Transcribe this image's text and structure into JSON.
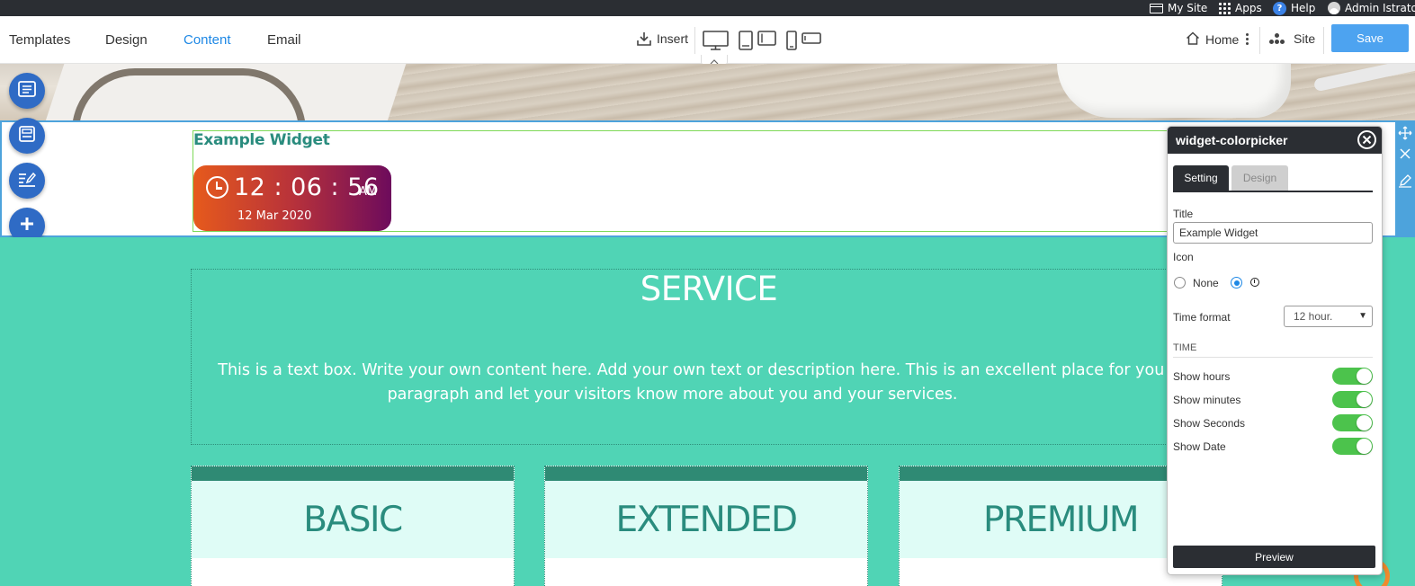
{
  "adminbar": {
    "my_site": "My Site",
    "apps": "Apps",
    "help": "Help",
    "user": "Admin Istrator",
    "help_glyph": "?"
  },
  "toolbar": {
    "menu": [
      "Templates",
      "Design",
      "Content",
      "Email"
    ],
    "active_menu": "Content",
    "insert_label": "Insert",
    "home_label": "Home",
    "site_label": "Site",
    "save_label": "Save"
  },
  "widget": {
    "title": "Example Widget",
    "time": "12 : 06 : 56",
    "ampm": "AM",
    "date": "12 Mar 2020"
  },
  "services": {
    "title": "SERVICE",
    "text_line1": "This is a text box. Write your own content here. Add your own text or description here. This is an excellent place for you to a",
    "text_line2": "paragraph and let your visitors know more about you and your services.",
    "plans": [
      "BASIC",
      "EXTENDED",
      "PREMIUM"
    ]
  },
  "panel": {
    "header": "widget-colorpicker",
    "tabs": [
      "Setting",
      "Design"
    ],
    "title_label": "Title",
    "title_value": "Example Widget",
    "icon_label": "Icon",
    "icon_none_label": "None",
    "icon_selected": "clock",
    "time_format_label": "Time format",
    "time_format_value": "12 hour.",
    "time_section": "TIME",
    "toggles": [
      {
        "label": "Show hours",
        "on": true
      },
      {
        "label": "Show minutes",
        "on": true
      },
      {
        "label": "Show Seconds",
        "on": true
      },
      {
        "label": "Show Date",
        "on": true
      }
    ],
    "preview_label": "Preview"
  },
  "colors": {
    "accent_blue": "#1e88e5",
    "save_button": "#4da3f0",
    "teal_section": "#50d4b5",
    "dark": "#2b2e33",
    "toggle_on": "#4cc34c"
  }
}
